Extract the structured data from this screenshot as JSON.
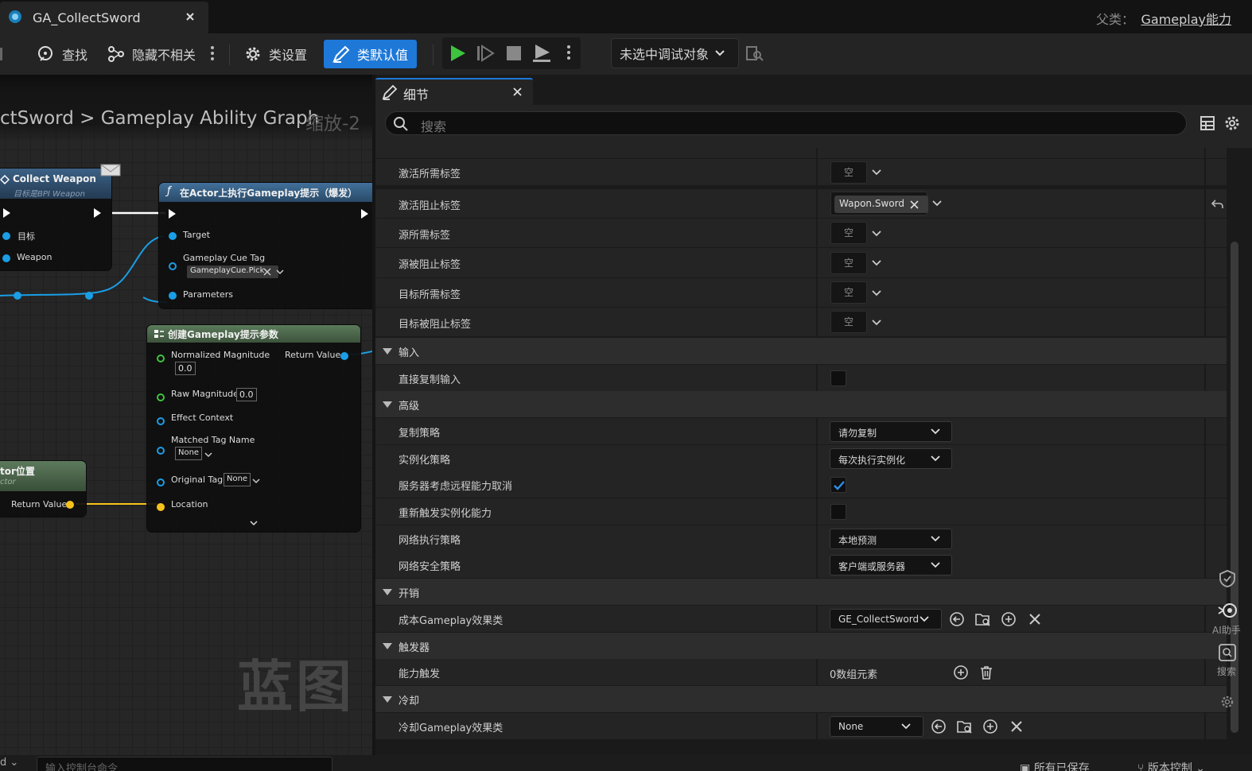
{
  "window": {
    "tab_title": "GA_CollectSword",
    "parent_label": "父类：",
    "parent_value": "Gameplay能力"
  },
  "toolbar": {
    "find": "查找",
    "hide_unrelated": "隐藏不相关",
    "class_settings": "类设置",
    "class_defaults": "类默认值",
    "debug_target": "未选中调试对象"
  },
  "graph": {
    "breadcrumb": "ctSword > Gameplay Ability Graph",
    "zoom": "缩放-2",
    "watermark": "蓝图",
    "node_collect": {
      "title": "Collect Weapon",
      "subtitle": "目标是BPI Weapon",
      "pin_target": "目标",
      "pin_weapon": "Weapon"
    },
    "node_execute": {
      "title": "在Actor上执行Gameplay提示（爆发）",
      "pin_target": "Target",
      "pin_cue_tag": "Gameplay Cue Tag",
      "cue_tag_value": "GameplayCue.Pick",
      "pin_params": "Parameters"
    },
    "node_create": {
      "title": "创建Gameplay提示参数",
      "pin_norm": "Normalized Magnitude",
      "norm_value": "0.0",
      "pin_return": "Return Value",
      "pin_raw": "Raw Magnitude",
      "raw_value": "0.0",
      "pin_effect": "Effect Context",
      "pin_matched": "Matched Tag Name",
      "matched_value": "None",
      "pin_original": "Original Tag",
      "original_value": "None",
      "pin_location": "Location"
    },
    "node_location": {
      "title": "tor位置",
      "subtitle": "ctor",
      "pin_return": "Return Value"
    }
  },
  "console": {
    "placeholder": "输入控制台命令",
    "left_label": "d",
    "saved": "所有已保存",
    "version_control": "版本控制"
  },
  "details": {
    "tab_label": "细节",
    "search_placeholder": "搜索",
    "rows": {
      "activation_required": {
        "label": "激活所需标签",
        "value": "空"
      },
      "activation_blocked": {
        "label": "激活阻止标签",
        "tag": "Wapon.Sword"
      },
      "source_required": {
        "label": "源所需标签",
        "value": "空"
      },
      "source_blocked": {
        "label": "源被阻止标签",
        "value": "空"
      },
      "target_required": {
        "label": "目标所需标签",
        "value": "空"
      },
      "target_blocked": {
        "label": "目标被阻止标签",
        "value": "空"
      },
      "cat_input": "输入",
      "direct_replicate": {
        "label": "直接复制输入",
        "checked": false
      },
      "cat_advanced": "高级",
      "replication_policy": {
        "label": "复制策略",
        "value": "请勿复制"
      },
      "instancing_policy": {
        "label": "实例化策略",
        "value": "每次执行实例化"
      },
      "server_respects_cancel": {
        "label": "服务器考虑远程能力取消",
        "checked": true
      },
      "retrigger": {
        "label": "重新触发实例化能力",
        "checked": false
      },
      "net_exec_policy": {
        "label": "网络执行策略",
        "value": "本地预测"
      },
      "net_security_policy": {
        "label": "网络安全策略",
        "value": "客户端或服务器"
      },
      "cat_costs": "开销",
      "cost_effect": {
        "label": "成本Gameplay效果类",
        "value": "GE_CollectSword"
      },
      "cat_triggers": "触发器",
      "ability_triggers": {
        "label": "能力触发",
        "value": "0数组元素"
      },
      "cat_cooldowns": "冷却",
      "cooldown_effect": {
        "label": "冷却Gameplay效果类",
        "value": "None"
      }
    }
  },
  "sidebar": {
    "ai_assistant": "AI助手",
    "search": "搜索"
  },
  "colors": {
    "accent": "#1d78d8",
    "play": "#3ec43e",
    "pin_blue": "#1a9ee6",
    "pin_yellow": "#f7c31b"
  }
}
